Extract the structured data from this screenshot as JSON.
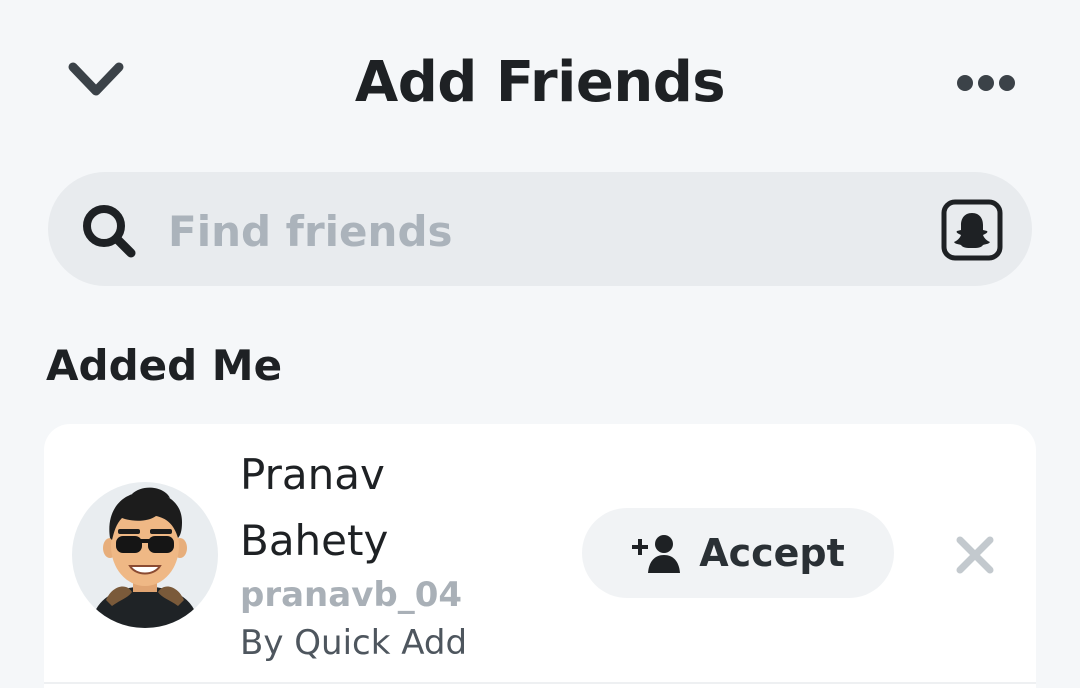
{
  "header": {
    "title": "Add Friends",
    "back_icon": "chevron-down-icon",
    "more_icon": "more-horizontal-icon"
  },
  "search": {
    "placeholder": "Find friends",
    "value": "",
    "search_icon": "search-icon",
    "snapcode_icon": "snapcode-icon"
  },
  "section": {
    "title": "Added Me"
  },
  "friend_request": {
    "name": "Pranav Bahety",
    "username": "pranavb_04",
    "source": "By Quick Add",
    "accept_label": "Accept",
    "accept_icon": "add-friend-icon",
    "dismiss_icon": "close-icon"
  },
  "colors": {
    "background": "#f5f7f9",
    "search_bg": "#e8ebee",
    "card_bg": "#ffffff",
    "placeholder": "#abb3bb",
    "muted_text": "#a9b0b7",
    "accept_bg": "#f1f3f5"
  }
}
